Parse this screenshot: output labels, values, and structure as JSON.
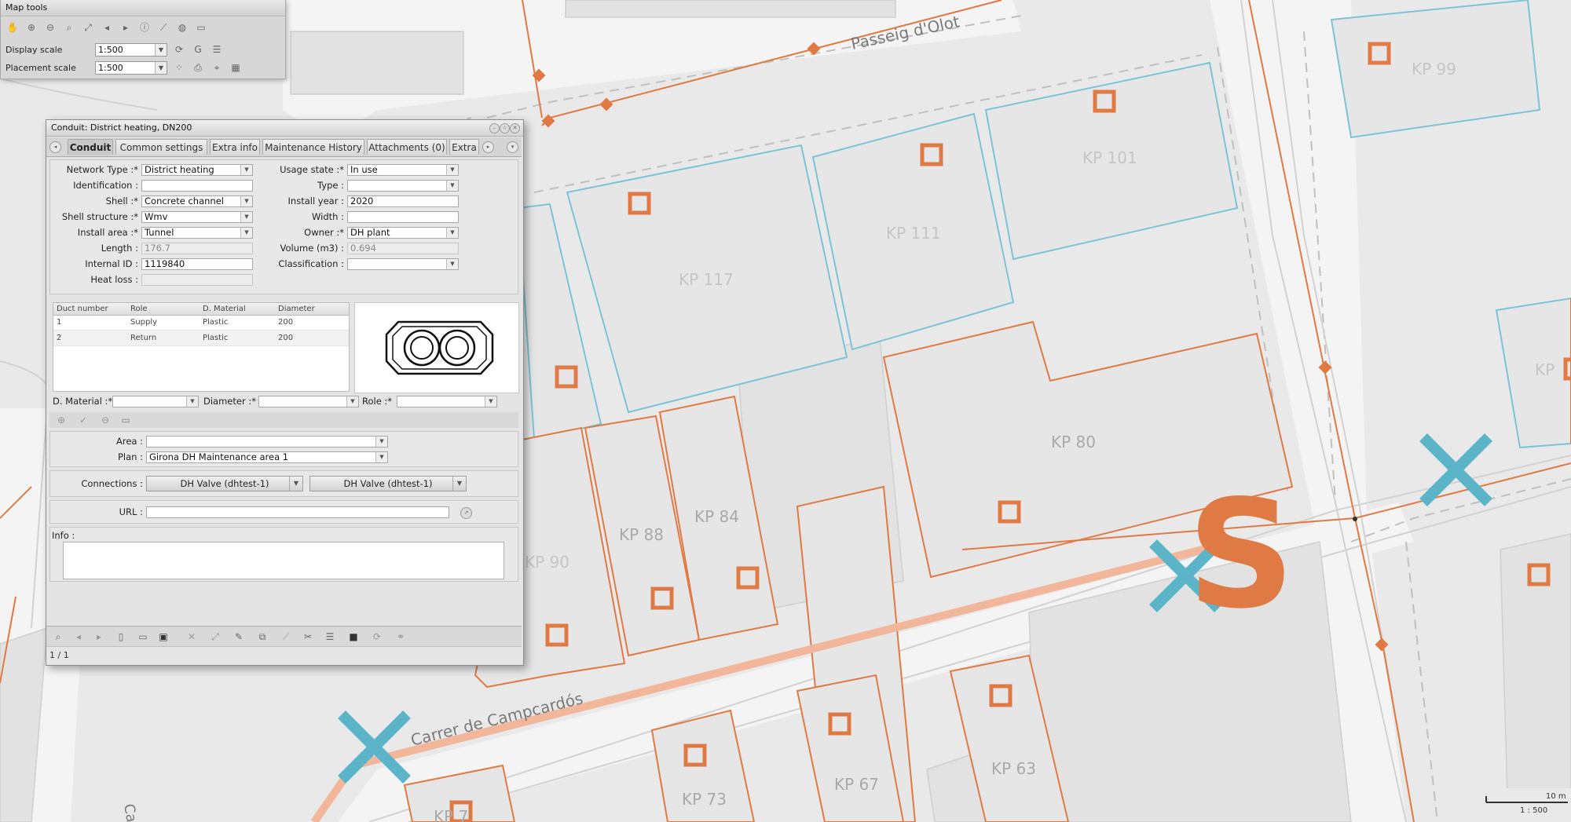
{
  "map": {
    "streets": {
      "passeig": "Passeig d'Olot",
      "carrer": "Carrer de Campcardós",
      "partial": "Ca"
    },
    "parcels": [
      "KP 99",
      "KP 101",
      "KP 111",
      "KP 117",
      "KP 80",
      "KP",
      "KP 88",
      "KP 84",
      "KP 90",
      "KP 67",
      "KP 63",
      "KP 73",
      "KP 7"
    ],
    "scalebar": {
      "distance": "10 m",
      "ratio": "1 : 500"
    },
    "colors": {
      "network": "#e07a44",
      "parcel_blue": "#7cc3d8",
      "marker_x": "#5bb4c8",
      "route": "#f2b79a",
      "start_marker": "#e07a44"
    },
    "start_label": "S"
  },
  "map_tools": {
    "title": "Map tools",
    "display_scale_label": "Display scale",
    "display_scale_value": "1:500",
    "placement_scale_label": "Placement scale",
    "placement_scale_value": "1:500"
  },
  "dialog": {
    "title": "Conduit: District heating, DN200",
    "tabs": [
      "Conduit",
      "Common settings",
      "Extra info",
      "Maintenance History",
      "Attachments (0)",
      "Extra"
    ],
    "active_tab": "Conduit",
    "fields": {
      "network_type_label": "Network Type :*",
      "network_type": "District heating",
      "identification_label": "Identification :",
      "identification": "",
      "shell_label": "Shell :*",
      "shell": "Concrete channel",
      "shell_structure_label": "Shell structure :*",
      "shell_structure": "Wmv",
      "install_area_label": "Install area :*",
      "install_area": "Tunnel",
      "length_label": "Length :",
      "length": "176.7",
      "internal_id_label": "Internal ID :",
      "internal_id": "1119840",
      "heat_loss_label": "Heat loss :",
      "heat_loss": "",
      "usage_state_label": "Usage state :*",
      "usage_state": "In use",
      "type_label": "Type :",
      "type": "",
      "install_year_label": "Install year :",
      "install_year": "2020",
      "width_label": "Width :",
      "width": "",
      "owner_label": "Owner :*",
      "owner": "DH plant",
      "volume_label": "Volume (m3) :",
      "volume": "0.694",
      "classification_label": "Classification :",
      "classification": ""
    },
    "duct_table": {
      "columns": [
        "Duct number",
        "Role",
        "D. Material",
        "Diameter"
      ],
      "rows": [
        [
          "1",
          "Supply",
          "Plastic",
          "200"
        ],
        [
          "2",
          "Return",
          "Plastic",
          "200"
        ]
      ]
    },
    "duct_edit": {
      "material_label": "D. Material :*",
      "diameter_label": "Diameter :*",
      "role_label": "Role :*"
    },
    "area_label": "Area :",
    "area": "",
    "plan_label": "Plan :",
    "plan": "Girona DH Maintenance area 1",
    "connections_label": "Connections :",
    "connection_1": "DH Valve (dhtest-1)",
    "connection_2": "DH Valve (dhtest-1)",
    "url_label": "URL :",
    "url": "",
    "info_label": "Info :",
    "info": "",
    "status": "1 / 1"
  }
}
